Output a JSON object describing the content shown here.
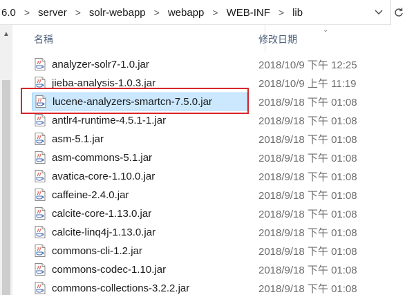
{
  "breadcrumb": {
    "items": [
      "6.0",
      "server",
      "solr-webapp",
      "webapp",
      "WEB-INF",
      "lib"
    ]
  },
  "header": {
    "name_label": "名稱",
    "date_label": "修改日期"
  },
  "files": [
    {
      "name": "analyzer-solr7-1.0.jar",
      "date": "2018/10/9 下午 12:25",
      "selected": false
    },
    {
      "name": "jieba-analysis-1.0.3.jar",
      "date": "2018/10/9 上午 11:19",
      "selected": false
    },
    {
      "name": "lucene-analyzers-smartcn-7.5.0.jar",
      "date": "2018/9/18 下午 01:08",
      "selected": true
    },
    {
      "name": "antlr4-runtime-4.5.1-1.jar",
      "date": "2018/9/18 下午 01:08",
      "selected": false
    },
    {
      "name": "asm-5.1.jar",
      "date": "2018/9/18 下午 01:08",
      "selected": false
    },
    {
      "name": "asm-commons-5.1.jar",
      "date": "2018/9/18 下午 01:08",
      "selected": false
    },
    {
      "name": "avatica-core-1.10.0.jar",
      "date": "2018/9/18 下午 01:08",
      "selected": false
    },
    {
      "name": "caffeine-2.4.0.jar",
      "date": "2018/9/18 下午 01:08",
      "selected": false
    },
    {
      "name": "calcite-core-1.13.0.jar",
      "date": "2018/9/18 下午 01:08",
      "selected": false
    },
    {
      "name": "calcite-linq4j-1.13.0.jar",
      "date": "2018/9/18 下午 01:08",
      "selected": false
    },
    {
      "name": "commons-cli-1.2.jar",
      "date": "2018/9/18 下午 01:08",
      "selected": false
    },
    {
      "name": "commons-codec-1.10.jar",
      "date": "2018/9/18 下午 01:08",
      "selected": false
    },
    {
      "name": "commons-collections-3.2.2.jar",
      "date": "2018/9/18 下午 01:08",
      "selected": false
    }
  ],
  "icons": {
    "file": "jar-file-icon",
    "separator": "chevron-right-icon",
    "dropdown": "chevron-down-icon",
    "refresh": "refresh-icon"
  },
  "colors": {
    "selection_fill": "#cce8ff",
    "selection_border": "#99d1ff",
    "annotation_box": "#d6262b"
  }
}
